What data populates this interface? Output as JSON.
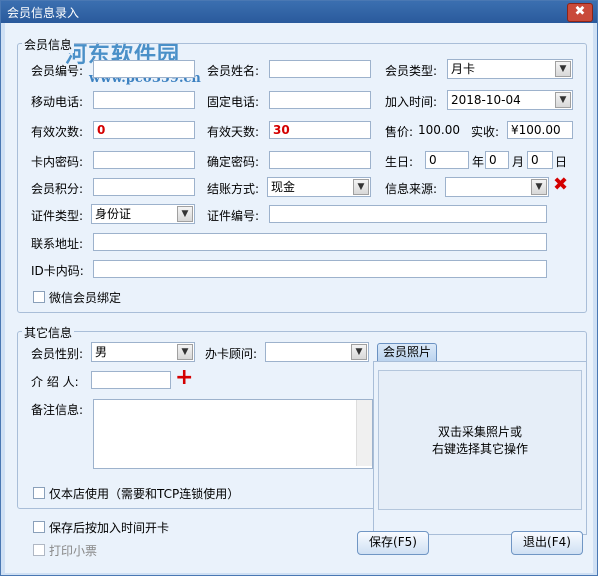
{
  "window": {
    "title": "会员信息录入",
    "close": "✖"
  },
  "watermark": {
    "brand": "河东软件园",
    "url": "www.pc0359.cn"
  },
  "member_info": {
    "group_title": "会员信息",
    "member_no": {
      "label": "会员编号:",
      "value": ""
    },
    "member_name": {
      "label": "会员姓名:",
      "value": ""
    },
    "member_type": {
      "label": "会员类型:",
      "value": "月卡"
    },
    "mobile": {
      "label": "移动电话:",
      "value": ""
    },
    "phone": {
      "label": "固定电话:",
      "value": ""
    },
    "join_time": {
      "label": "加入时间:",
      "value": "2018-10-04"
    },
    "valid_times": {
      "label": "有效次数:",
      "value": "0"
    },
    "valid_days": {
      "label": "有效天数:",
      "value": "30"
    },
    "price": {
      "label": "售价:",
      "value": "100.00"
    },
    "paid": {
      "label": "实收:",
      "value": "¥100.00"
    },
    "card_pwd": {
      "label": "卡内密码:",
      "value": ""
    },
    "confirm_pwd": {
      "label": "确定密码:",
      "value": ""
    },
    "birthday": {
      "label": "生日:",
      "year": "0",
      "year_unit": "年",
      "month": "0",
      "month_unit": "月",
      "day": "0",
      "day_unit": "日"
    },
    "points": {
      "label": "会员积分:",
      "value": ""
    },
    "settle": {
      "label": "结账方式:",
      "value": "现金"
    },
    "source": {
      "label": "信息来源:",
      "value": ""
    },
    "id_type": {
      "label": "证件类型:",
      "value": "身份证"
    },
    "id_no": {
      "label": "证件编号:",
      "value": ""
    },
    "address": {
      "label": "联系地址:",
      "value": ""
    },
    "idcard_code": {
      "label": "ID卡内码:",
      "value": ""
    },
    "wechat_bind": {
      "label": "微信会员绑定",
      "checked": false
    }
  },
  "other_info": {
    "group_title": "其它信息",
    "gender": {
      "label": "会员性别:",
      "value": "男"
    },
    "advisor": {
      "label": "办卡顾问:",
      "value": ""
    },
    "referrer": {
      "label": "介 绍 人:",
      "value": ""
    },
    "remarks": {
      "label": "备注信息:",
      "value": ""
    },
    "store_only": {
      "label": "仅本店使用（需要和TCP连锁使用）",
      "checked": false
    }
  },
  "photo": {
    "tab": "会员照片",
    "hint_line1": "双击采集照片或",
    "hint_line2": "右键选择其它操作"
  },
  "footer": {
    "open_card": {
      "label": "保存后按加入时间开卡",
      "checked": false
    },
    "print_ticket": {
      "label": "打印小票",
      "checked": false
    },
    "save_button": "保存(F5)",
    "exit_button": "退出(F4)"
  },
  "colors": {
    "accent_red": "#d40000",
    "title_bar": "#2a5a9c",
    "background": "#eaf2fb"
  }
}
